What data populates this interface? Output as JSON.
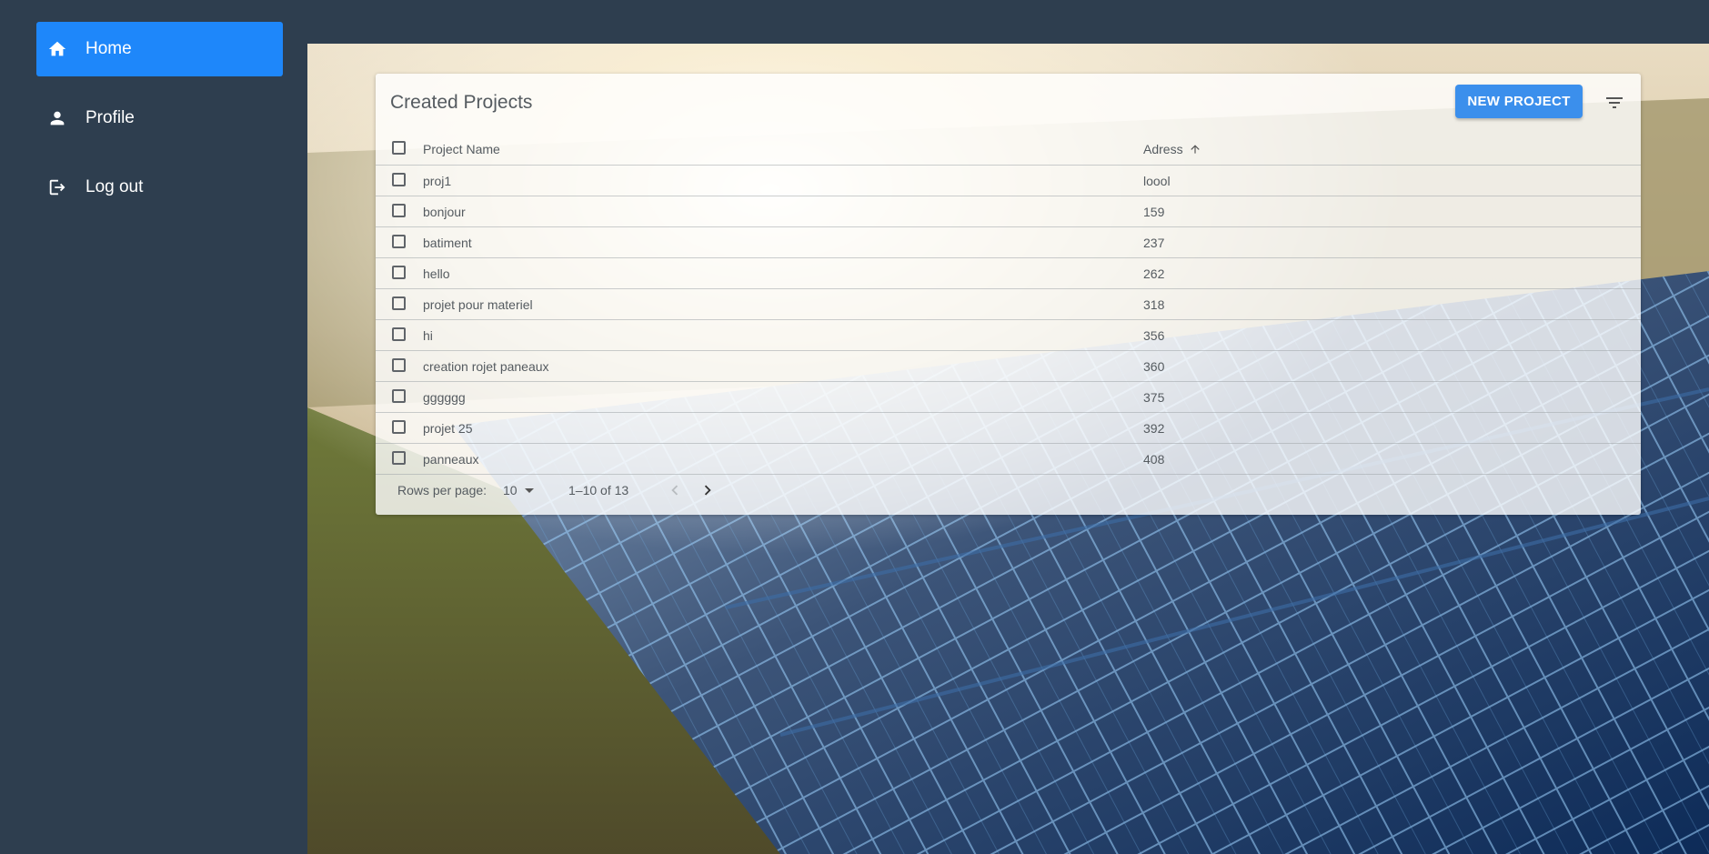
{
  "sidebar": {
    "items": [
      {
        "label": "Home",
        "icon": "home-icon",
        "active": true
      },
      {
        "label": "Profile",
        "icon": "person-icon",
        "active": false
      },
      {
        "label": "Log out",
        "icon": "logout-icon",
        "active": false
      }
    ]
  },
  "card": {
    "title": "Created Projects",
    "new_button_label": "NEW PROJECT"
  },
  "table": {
    "columns": [
      "Project Name",
      "Adress"
    ],
    "sort": "ascending",
    "rows": [
      {
        "name": "proj1",
        "address": "loool"
      },
      {
        "name": "bonjour",
        "address": "159"
      },
      {
        "name": "batiment",
        "address": "237"
      },
      {
        "name": "hello",
        "address": "262"
      },
      {
        "name": "projet pour materiel",
        "address": "318"
      },
      {
        "name": "hi",
        "address": "356"
      },
      {
        "name": "creation rojet paneaux",
        "address": "360"
      },
      {
        "name": "gggggg",
        "address": "375"
      },
      {
        "name": "projet 25",
        "address": "392"
      },
      {
        "name": "panneaux",
        "address": "408"
      }
    ]
  },
  "pagination": {
    "rows_per_page_label": "Rows per page:",
    "rows_per_page_value": "10",
    "range_text": "1–10 of 13"
  },
  "colors": {
    "sidebar_bg": "#2e3e4f",
    "active_nav": "#1e87fa",
    "primary_button": "#3b8fec"
  }
}
